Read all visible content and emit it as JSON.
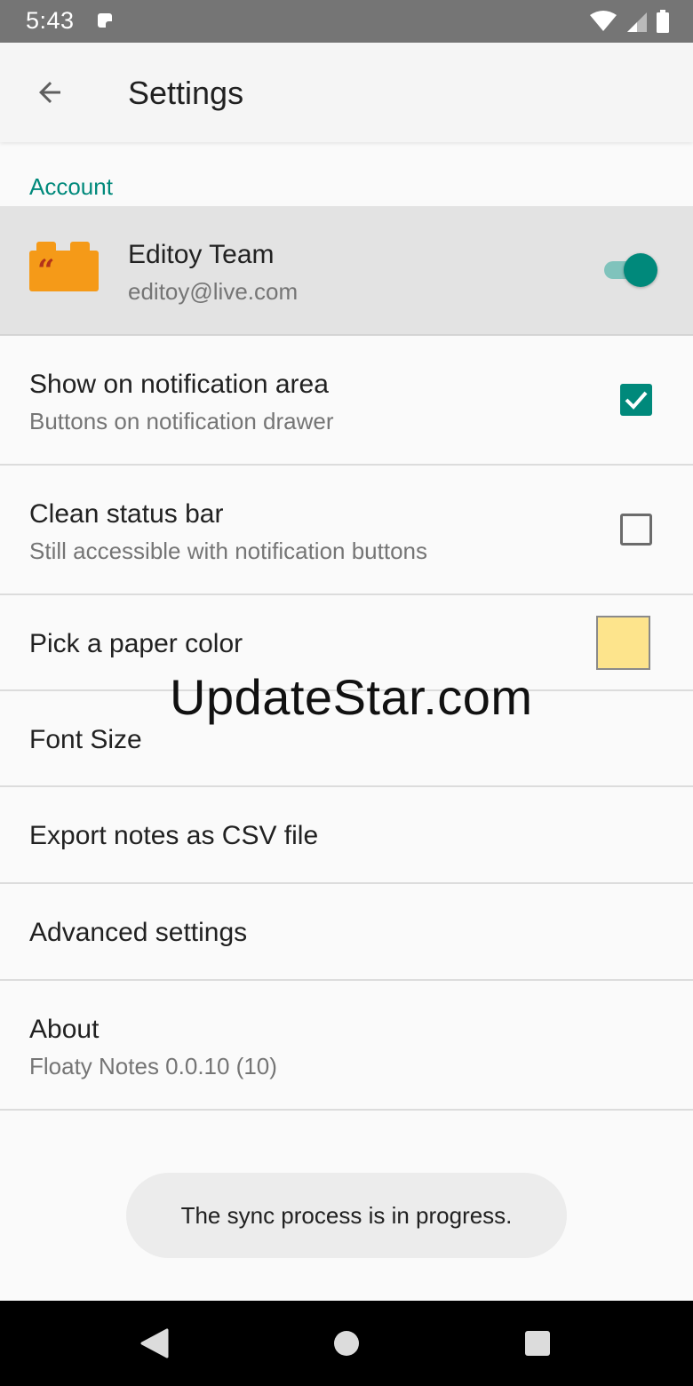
{
  "status_bar": {
    "time": "5:43"
  },
  "app_bar": {
    "title": "Settings"
  },
  "account": {
    "section_header": "Account",
    "name": "Editoy Team",
    "email": "editoy@live.com",
    "toggle_on": true,
    "logo_color": "#f59a18",
    "logo_mark_color": "#b3331a"
  },
  "settings": {
    "notification_area": {
      "title": "Show on notification area",
      "subtitle": "Buttons on notification drawer",
      "checked": true
    },
    "clean_status_bar": {
      "title": "Clean status bar",
      "subtitle": "Still accessible with notification buttons",
      "checked": false
    },
    "paper_color": {
      "title": "Pick a paper color",
      "swatch_color": "#fde48c"
    },
    "font_size": {
      "title": "Font Size"
    },
    "export_csv": {
      "title": "Export notes as CSV file"
    },
    "advanced": {
      "title": "Advanced settings"
    },
    "about": {
      "title": "About",
      "subtitle": "Floaty Notes 0.0.10 (10)"
    }
  },
  "watermark": "UpdateStar.com",
  "toast": "The sync process is in progress.",
  "colors": {
    "accent": "#00897b",
    "status_bar": "#757575",
    "app_bar": "#f5f5f5",
    "background": "#fafafa"
  }
}
